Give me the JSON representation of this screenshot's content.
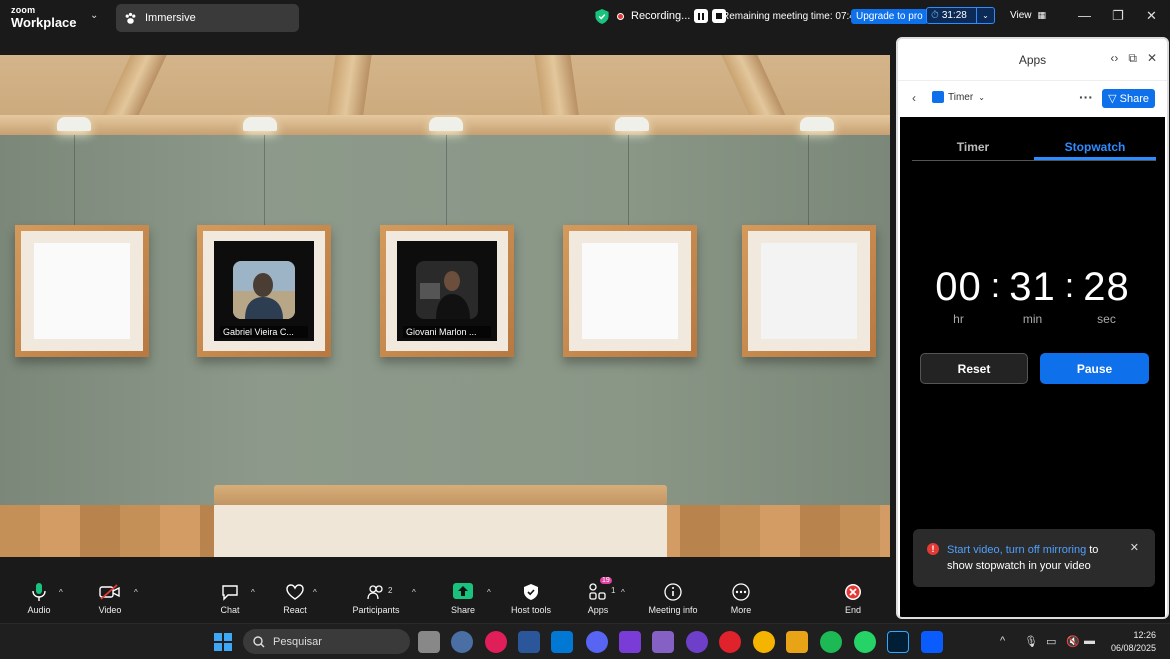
{
  "window": {
    "brand_small": "zoom",
    "brand_large": "Workplace",
    "view_mode": "Immersive",
    "recording_label": "Recording...",
    "remaining_time": "Remaining meeting time: 07:40",
    "upgrade_label": "Upgrade to pro",
    "timer_value": "31:28",
    "view_label": "View"
  },
  "scene": {
    "participants": [
      {
        "name": "Gabriel Vieira C..."
      },
      {
        "name": "Giovani Marlon ..."
      }
    ]
  },
  "apps_panel": {
    "title": "Apps",
    "app_name": "Timer",
    "share_label": "Share",
    "tabs": [
      {
        "label": "Timer",
        "active": false
      },
      {
        "label": "Stopwatch",
        "active": true
      }
    ],
    "stopwatch": {
      "hours": "00",
      "minutes": "31",
      "seconds": "28",
      "hours_label": "hr",
      "minutes_label": "min",
      "seconds_label": "sec"
    },
    "reset_label": "Reset",
    "pause_label": "Pause",
    "toast": {
      "link_text": "Start video, turn off mirroring",
      "rest_text": " to show stopwatch in your video"
    }
  },
  "toolbar": {
    "audio": "Audio",
    "video": "Video",
    "chat": "Chat",
    "react": "React",
    "participants": "Participants",
    "participants_count": "2",
    "share": "Share",
    "host_tools": "Host tools",
    "apps": "Apps",
    "apps_count": "1",
    "apps_badge": "19",
    "meeting_info": "Meeting info",
    "more": "More",
    "end": "End"
  },
  "taskbar": {
    "search_placeholder": "Pesquisar",
    "time": "12:26",
    "date": "06/08/2025"
  },
  "colors": {
    "accent": "#0e71eb",
    "recording": "#e53935",
    "share_green": "#19c37d"
  }
}
